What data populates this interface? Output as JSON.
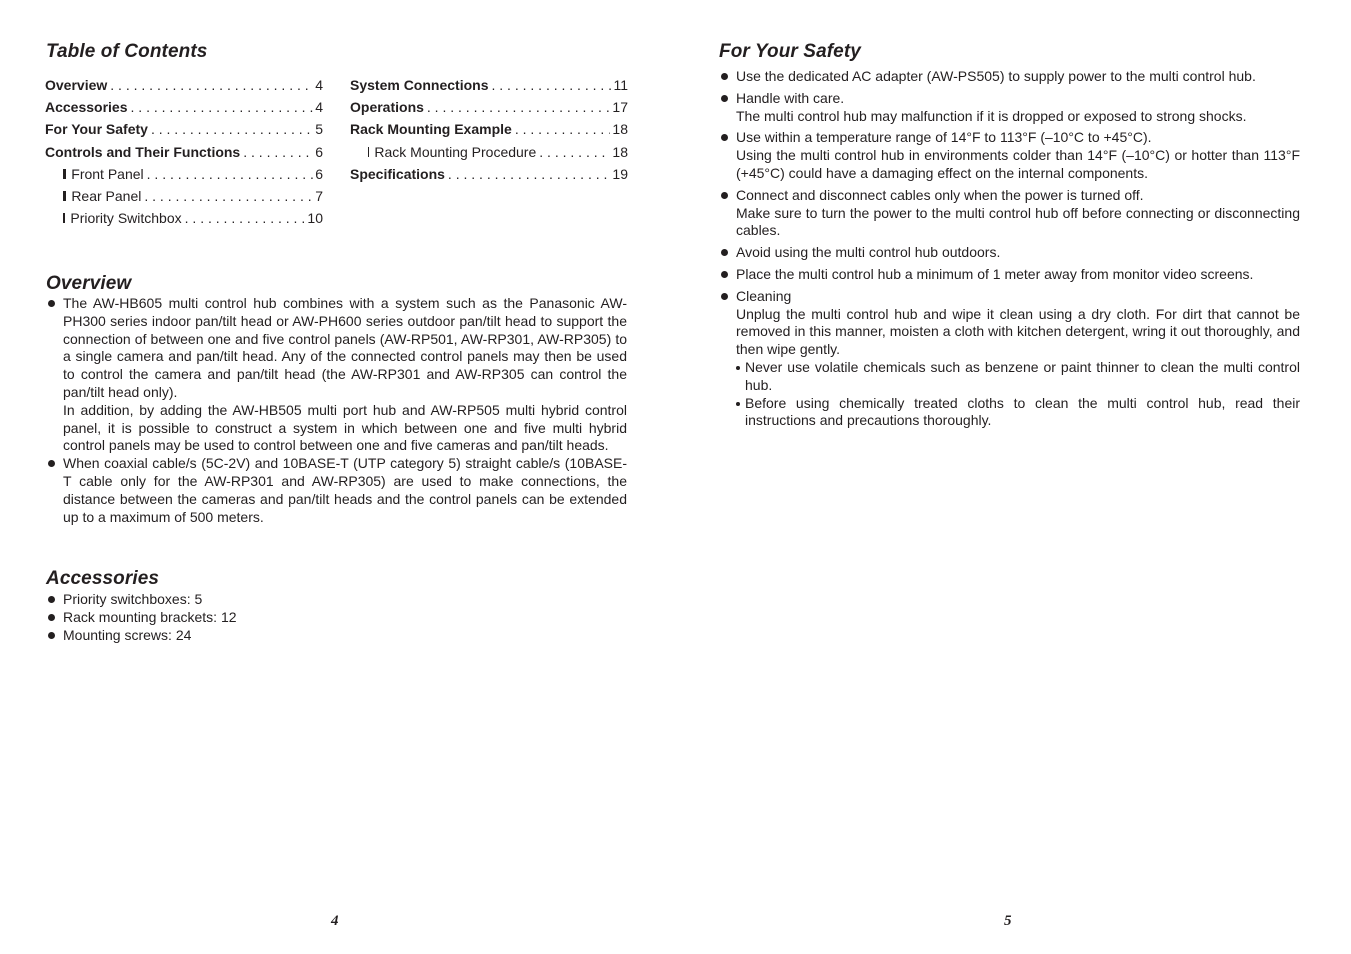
{
  "left_page": {
    "toc": {
      "title": "Table of Contents",
      "column1": [
        {
          "label": "Overview",
          "page": "4",
          "level": "main"
        },
        {
          "label": "Accessories",
          "page": "4",
          "level": "main"
        },
        {
          "label": "For Your Safety",
          "page": "5",
          "level": "main"
        },
        {
          "label": "Controls and Their Functions",
          "page": "6",
          "level": "main"
        },
        {
          "label": "Front Panel",
          "page": "6",
          "level": "sub"
        },
        {
          "label": "Rear Panel",
          "page": "7",
          "level": "sub"
        },
        {
          "label": "Priority Switchbox",
          "page": "10",
          "level": "sub"
        }
      ],
      "column2": [
        {
          "label": "System Connections",
          "page": "11",
          "level": "main"
        },
        {
          "label": "Operations",
          "page": "17",
          "level": "main"
        },
        {
          "label": "Rack Mounting Example",
          "page": "18",
          "level": "main"
        },
        {
          "label": "Rack Mounting Procedure",
          "page": "18",
          "level": "sub"
        },
        {
          "label": "Specifications",
          "page": "19",
          "level": "main"
        }
      ]
    },
    "overview": {
      "title": "Overview",
      "items": [
        {
          "paragraphs": [
            "The AW-HB605 multi control hub combines with a system such as the Panasonic AW-PH300 series indoor pan/tilt head or AW-PH600 series outdoor pan/tilt head to support the connection of between one and five control panels (AW-RP501, AW-RP301, AW-RP305) to a single camera and pan/tilt head. Any of the connected control panels may then be used to control the camera and pan/tilt head (the AW-RP301 and AW-RP305 can control the pan/tilt head only).",
            "In addition, by adding the AW-HB505 multi port hub and AW-RP505 multi hybrid control panel, it is possible to construct a system in which between one and five multi hybrid control panels may be used to control between one and five cameras and pan/tilt heads."
          ]
        },
        {
          "paragraphs": [
            "When coaxial cable/s (5C-2V) and 10BASE-T (UTP category 5) straight cable/s (10BASE-T cable only for the AW-RP301 and AW-RP305) are used to make connections, the distance between the cameras and pan/tilt heads and the control panels can be extended up to a maximum of 500 meters."
          ]
        }
      ]
    },
    "accessories": {
      "title": "Accessories",
      "items": [
        "Priority switchboxes: 5",
        "Rack mounting brackets: 12",
        "Mounting screws: 24"
      ]
    },
    "page_number": "4"
  },
  "right_page": {
    "safety": {
      "title": "For Your Safety",
      "items": [
        {
          "heading": "Use the dedicated AC adapter (AW-PS505) to supply power to the multi control hub.",
          "body": ""
        },
        {
          "heading": "Handle with care.",
          "body": "The multi control hub may malfunction if it is dropped or exposed to strong shocks."
        },
        {
          "heading": "Use within a temperature range of 14°F to 113°F (–10°C to +45°C).",
          "body": "Using the multi control hub in environments colder than 14°F (–10°C) or hotter than 113°F (+45°C) could have a damaging effect on the internal components."
        },
        {
          "heading": "Connect and disconnect cables only when the power is turned off.",
          "body": "Make sure to turn the power to the multi control hub off before connecting or disconnecting cables."
        },
        {
          "heading": "Avoid using the multi control hub outdoors.",
          "body": ""
        },
        {
          "heading": "Place the multi control hub a minimum of 1 meter away from monitor video screens.",
          "body": ""
        },
        {
          "heading": "Cleaning",
          "body": "Unplug the multi control hub and wipe it clean using a dry cloth. For dirt that cannot be removed in this manner, moisten a cloth with kitchen detergent, wring it out thoroughly, and then wipe gently.",
          "subitems": [
            "Never use volatile chemicals such as benzene or paint thinner to clean the multi control hub.",
            "Before using chemically treated cloths to clean the multi control hub, read their instructions and precautions thoroughly."
          ]
        }
      ]
    },
    "page_number": "5"
  }
}
